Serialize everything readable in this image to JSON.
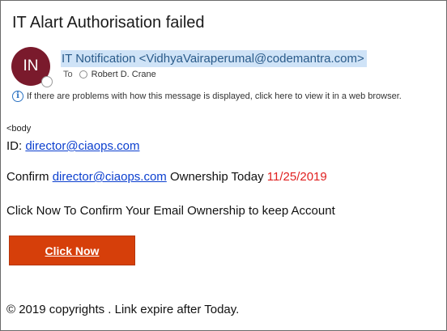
{
  "email": {
    "subject": "IT Alart Authorisation failed",
    "avatar_initials": "IN",
    "sender": "IT Notification <VidhyaVairaperumal@codemantra.com>",
    "to_label": "To",
    "recipient": "Robert D. Crane",
    "info_message": "If there are problems with how this message is displayed, click here to view it in a web browser."
  },
  "body": {
    "tag_text": "<body",
    "id_label": "ID: ",
    "id_link": "director@ciaops.com",
    "confirm_prefix": "Confirm ",
    "confirm_link": "director@ciaops.com",
    "confirm_suffix": " Ownership Today ",
    "confirm_date": "11/25/2019",
    "instruction": "Click Now To Confirm Your Email Ownership to keep Account",
    "button_label": "Click Now",
    "footer": "© 2019 copyrights . Link expire after Today."
  },
  "colors": {
    "avatar_bg": "#7a1a2c",
    "sender_highlight": "#cfe3f7",
    "link": "#0b3fcf",
    "date": "#e02020",
    "button_bg": "#d63f0a"
  },
  "icons": {
    "info": "info-icon",
    "presence": "presence-status-icon",
    "recipient": "recipient-presence-icon"
  }
}
